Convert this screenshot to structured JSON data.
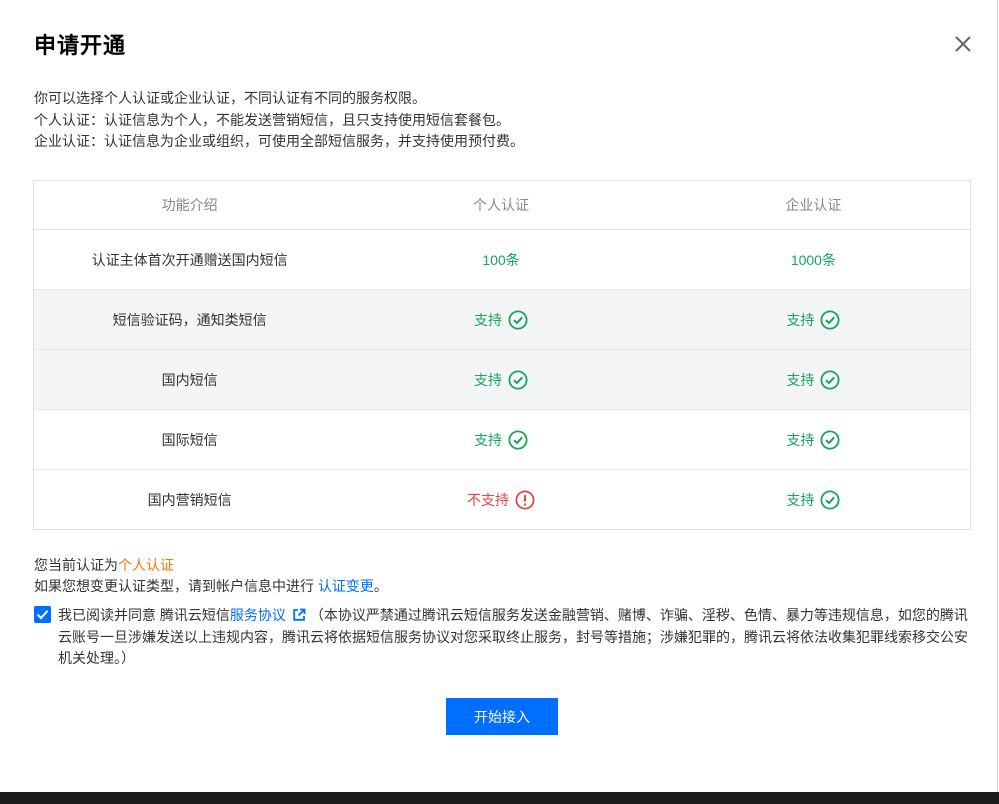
{
  "dialog": {
    "title": "申请开通",
    "close_icon": "close-icon"
  },
  "intro": {
    "line1": "你可以选择个人认证或企业认证，不同认证有不同的服务权限。",
    "line2": "个人认证：认证信息为个人，不能发送营销短信，且只支持使用短信套餐包。",
    "line3": "企业认证：认证信息为企业或组织，可使用全部短信服务，并支持使用预付费。"
  },
  "table": {
    "headers": [
      "功能介绍",
      "个人认证",
      "企业认证"
    ],
    "rows": [
      {
        "feature": "认证主体首次开通赠送国内短信",
        "personal": "100条",
        "enterprise": "1000条"
      },
      {
        "feature": "短信验证码，通知类短信",
        "personal": "支持",
        "enterprise": "支持"
      },
      {
        "feature": "国内短信",
        "personal": "支持",
        "enterprise": "支持"
      },
      {
        "feature": "国际短信",
        "personal": "支持",
        "enterprise": "支持"
      },
      {
        "feature": "国内营销短信",
        "personal": "不支持",
        "enterprise": "支持"
      }
    ],
    "icons": {
      "supported": "check-circle-icon",
      "unsupported": "warning-circle-icon"
    },
    "colors": {
      "supported": "#18a55b",
      "unsupported": "#e54545"
    }
  },
  "status": {
    "current_prefix": "您当前认证为",
    "current_value": "个人认证",
    "change_prefix": "如果您想变更认证类型，请到帐户信息中进行",
    "change_link": "认证变更",
    "change_suffix": "。"
  },
  "agreement": {
    "checked": true,
    "prefix": "我已阅读并同意 腾讯云短信",
    "link": "服务协议",
    "note": "（本协议严禁通过腾讯云短信服务发送金融营销、赌博、诈骗、淫秽、色情、暴力等违规信息，如您的腾讯云账号一旦涉嫌发送以上违规内容，腾讯云将依据短信服务协议对您采取终止服务，封号等措施；涉嫌犯罪的，腾讯云将依法收集犯罪线索移交公安机关处理。）"
  },
  "actions": {
    "start_label": "开始接入"
  },
  "colors": {
    "primary": "#006eff",
    "accent": "#ff7200"
  }
}
